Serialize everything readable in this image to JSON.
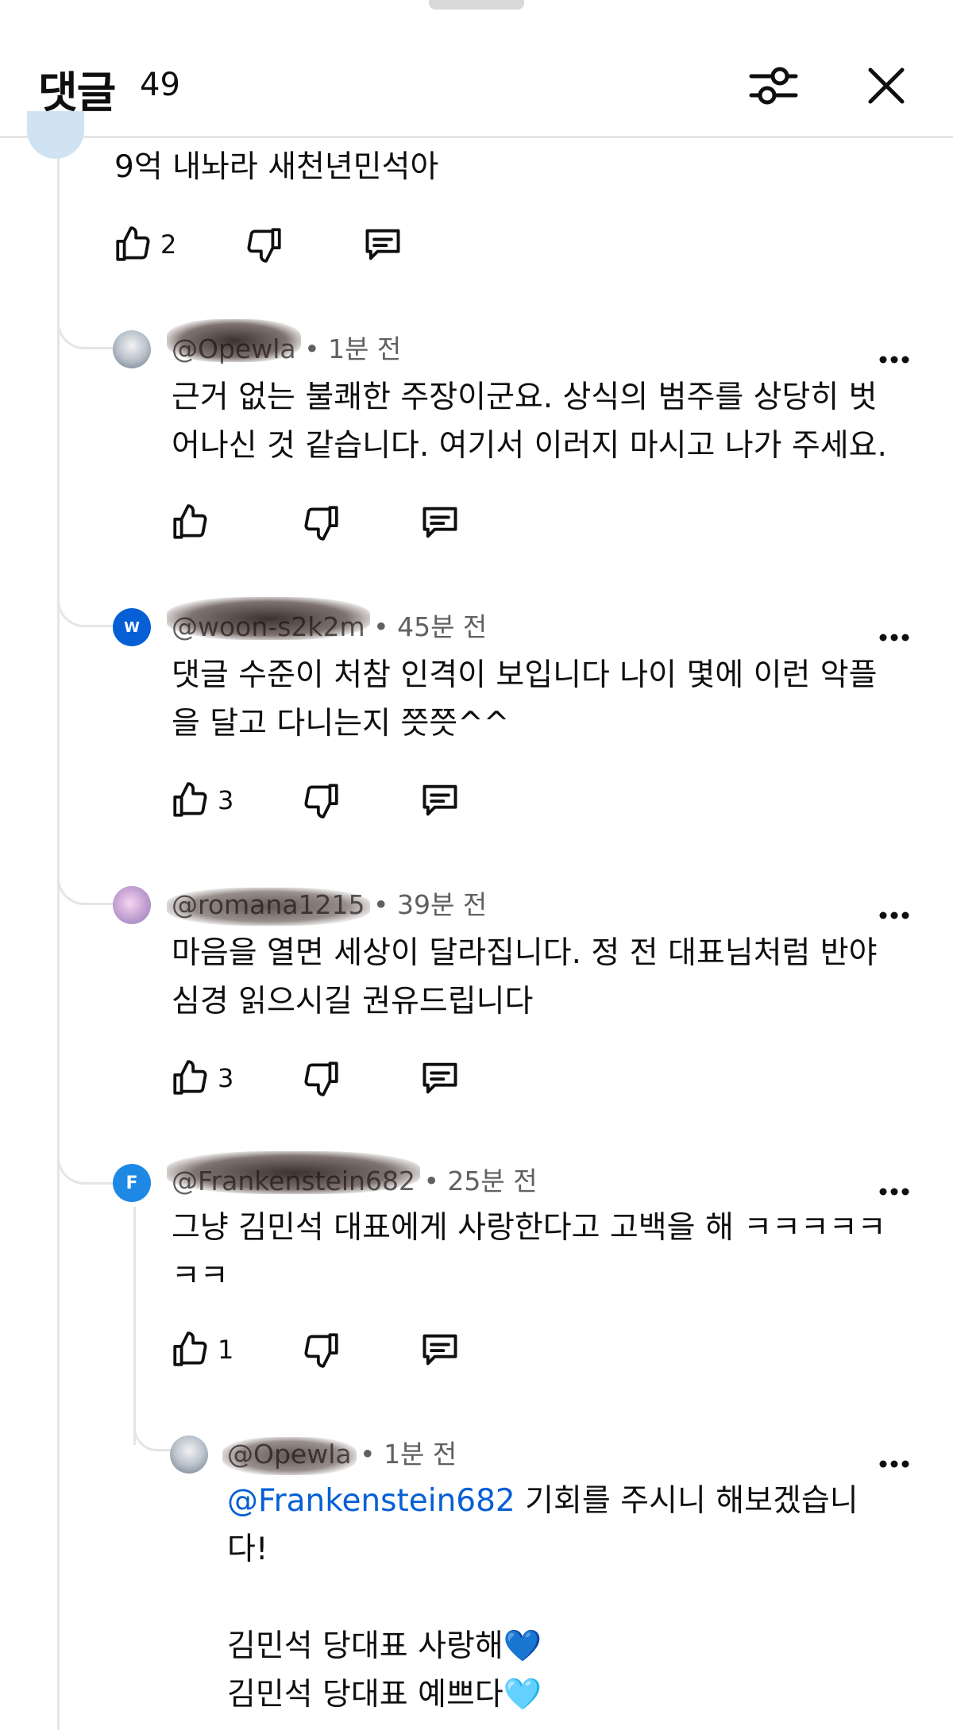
{
  "header": {
    "title": "댓글",
    "count": "49",
    "filter_icon": "sliders-icon",
    "close_icon": "close-icon"
  },
  "top_comment": {
    "text": "9억 내놔라 새천년민석아",
    "likes": "2"
  },
  "replies": [
    {
      "handle": "@Opewla",
      "time": "• 1분 전",
      "lines": [
        "근거 없는 불쾌한 주장이군요. 상식의 범주를 상당히 벗",
        "어나신 것 같습니다. 여기서 이러지 마시고 나가 주세요."
      ],
      "likes": ""
    },
    {
      "avatar_letter": "W",
      "handle": "@woon-s2k2m",
      "time": "• 45분 전",
      "lines": [
        "댓글 수준이 처참 인격이 보입니다 나이 몇에 이런 악플",
        "을 달고 다니는지 쯧쯧^^"
      ],
      "likes": "3"
    },
    {
      "handle": "@romana1215",
      "time": "• 39분 전",
      "lines": [
        "마음을 열면 세상이 달라집니다. 정 전 대표님처럼 반야",
        "심경 읽으시길 권유드립니다"
      ],
      "likes": "3"
    },
    {
      "avatar_letter": "F",
      "handle": "@Frankenstein682",
      "time": "• 25분 전",
      "lines": [
        "그냥 김민석 대표에게 사랑한다고 고백을 해 ㅋㅋㅋㅋㅋ",
        "ㅋㅋ"
      ],
      "likes": "1"
    },
    {
      "handle": "@Opewla",
      "time": "• 1분 전",
      "mention": "@Frankenstein682",
      "lines": [
        " 기회를 주시니 해보겠습니",
        "다!",
        "",
        "김민석 당대표 사랑해💙",
        "김민석 당대표 예쁘다🩵"
      ]
    }
  ],
  "colors": {
    "mention": "#065fd4",
    "meta": "#606060",
    "divider": "#e5e5e5"
  }
}
